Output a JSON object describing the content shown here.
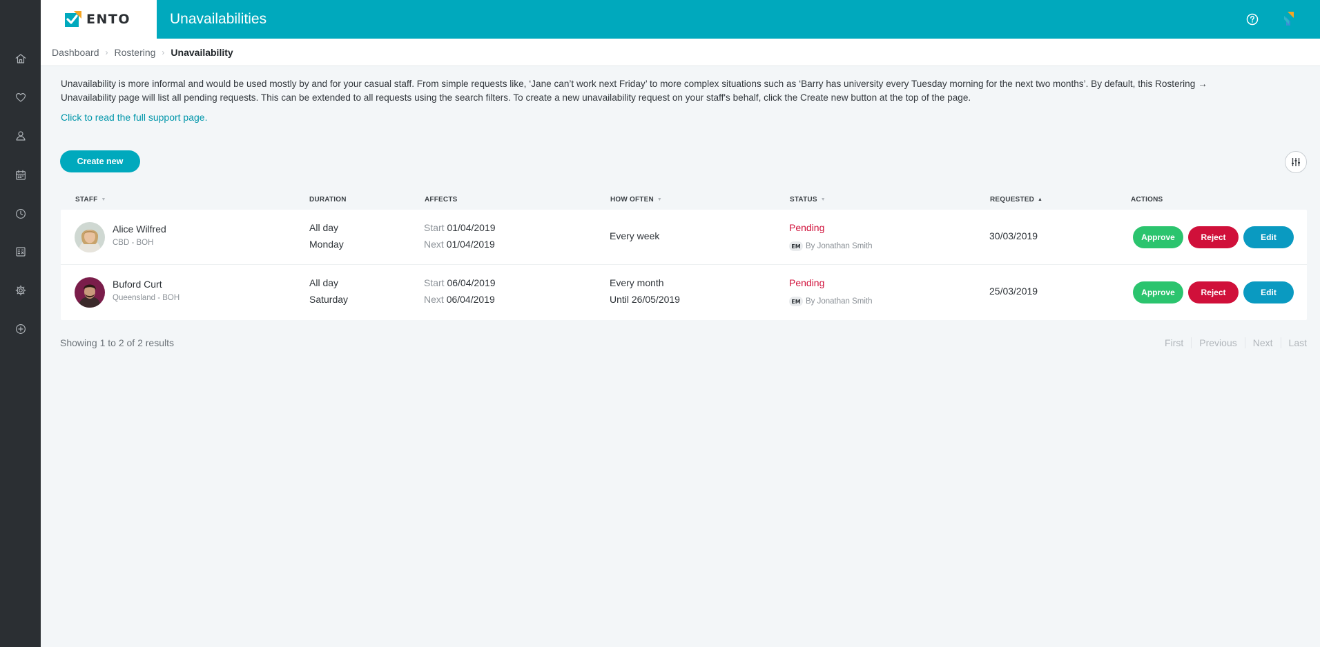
{
  "app": {
    "brand_name": "ENTO",
    "page_title": "Unavailabilities"
  },
  "breadcrumb": [
    {
      "label": "Dashboard"
    },
    {
      "label": "Rostering"
    },
    {
      "label": "Unavailability"
    }
  ],
  "sidebar": {
    "items": [
      {
        "icon": "home-icon"
      },
      {
        "icon": "heart-icon"
      },
      {
        "icon": "user-icon"
      },
      {
        "icon": "calendar-icon"
      },
      {
        "icon": "clock-icon"
      },
      {
        "icon": "calculator-icon"
      },
      {
        "icon": "gear-icon"
      },
      {
        "icon": "add-circle-icon"
      }
    ]
  },
  "intro": {
    "text": "Unavailability is more informal and would be used mostly by and for your casual staff. From simple requests like, ‘Jane can’t work next Friday’ to more complex situations such as ‘Barry has university every Tuesday morning for the next two months’. By default, this Rostering → Unavailability page will list all pending requests. This can be extended to all requests using the search filters. To create a new unavailability request on your staff's behalf, click the Create new button at the top of the page.",
    "support_link": "Click to read the full support page."
  },
  "toolbar": {
    "create_label": "Create new"
  },
  "table": {
    "columns": {
      "staff": "STAFF",
      "duration": "DURATION",
      "affects": "AFFECTS",
      "how_often": "HOW OFTEN",
      "status": "STATUS",
      "requested": "REQUESTED",
      "actions": "ACTIONS"
    },
    "rows": [
      {
        "name": "Alice Wilfred",
        "location": "CBD - BOH",
        "duration_type": "All day",
        "duration_day": "Monday",
        "start_label": "Start",
        "start_date": "01/04/2019",
        "next_label": "Next",
        "next_date": "01/04/2019",
        "how_often": "Every week",
        "how_often_until": "",
        "status": "Pending",
        "badge": "EM",
        "by": "By Jonathan Smith",
        "requested": "30/03/2019",
        "approve": "Approve",
        "reject": "Reject",
        "edit": "Edit"
      },
      {
        "name": "Buford Curt",
        "location": "Queensland - BOH",
        "duration_type": "All day",
        "duration_day": "Saturday",
        "start_label": "Start",
        "start_date": "06/04/2019",
        "next_label": "Next",
        "next_date": "06/04/2019",
        "how_often": "Every month",
        "how_often_until": "Until 26/05/2019",
        "status": "Pending",
        "badge": "EM",
        "by": "By Jonathan Smith",
        "requested": "25/03/2019",
        "approve": "Approve",
        "reject": "Reject",
        "edit": "Edit"
      }
    ]
  },
  "footer": {
    "results": "Showing 1 to 2 of 2 results",
    "pagination": {
      "first": "First",
      "previous": "Previous",
      "next": "Next",
      "last": "Last"
    }
  },
  "colors": {
    "brand_teal": "#00a9bd",
    "sidebar_bg": "#2b2f33",
    "approve_green": "#2bc46e",
    "reject_red": "#d0103a",
    "edit_blue": "#0a9ac1",
    "pending_red": "#d0103a"
  }
}
